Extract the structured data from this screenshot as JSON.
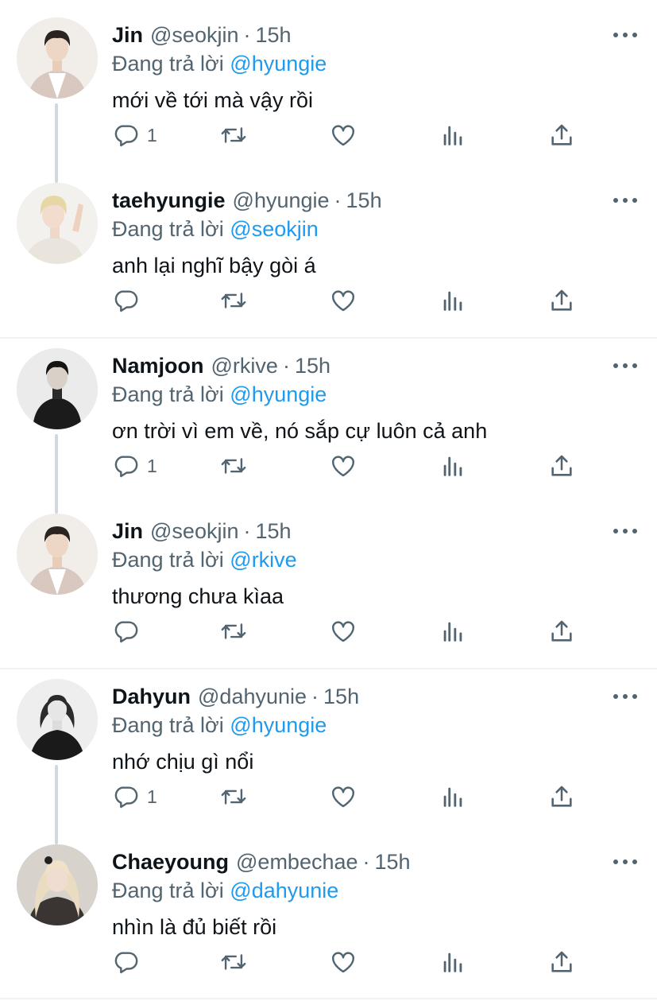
{
  "reply_prefix": "Đang trả lời",
  "dot": "·",
  "tweets": [
    {
      "name": "Jin",
      "handle": "@seokjin",
      "time": "15h",
      "reply_to": "@hyungie",
      "text": "mới về tới mà vậy rồi",
      "reply_count": "1",
      "avatar": "jin-avatar"
    },
    {
      "name": "taehyungie",
      "handle": "@hyungie",
      "time": "15h",
      "reply_to": "@seokjin",
      "text": "anh lại nghĩ bậy gòi á",
      "reply_count": "",
      "avatar": "taehyung-avatar"
    },
    {
      "name": "Namjoon",
      "handle": "@rkive",
      "time": "15h",
      "reply_to": "@hyungie",
      "text": "ơn trời vì em về, nó sắp cự luôn cả anh",
      "reply_count": "1",
      "avatar": "namjoon-avatar"
    },
    {
      "name": "Jin",
      "handle": "@seokjin",
      "time": "15h",
      "reply_to": "@rkive",
      "text": "thương chưa kìaa",
      "reply_count": "",
      "avatar": "jin-avatar"
    },
    {
      "name": "Dahyun",
      "handle": "@dahyunie",
      "time": "15h",
      "reply_to": "@hyungie",
      "text": "nhớ chịu gì nổi",
      "reply_count": "1",
      "avatar": "dahyun-avatar"
    },
    {
      "name": "Chaeyoung",
      "handle": "@embechae",
      "time": "15h",
      "reply_to": "@dahyunie",
      "text": "nhìn là đủ biết rồi",
      "reply_count": "",
      "avatar": "chaeyoung-avatar"
    }
  ],
  "colors": {
    "link": "#1d9bf0",
    "secondary": "#536471",
    "text": "#0f1419",
    "divider": "#eff3f4"
  }
}
